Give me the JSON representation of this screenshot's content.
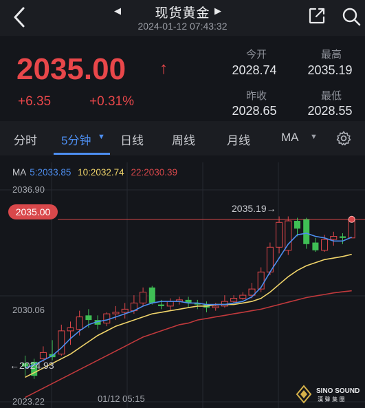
{
  "header": {
    "title": "现货黄金",
    "timestamp": "2024-01-12 07:43:32"
  },
  "quote": {
    "price": "2035.00",
    "change": "+6.35",
    "change_pct": "+0.31%",
    "open_label": "今开",
    "open": "2028.74",
    "high_label": "最高",
    "high": "2035.19",
    "prev_close_label": "昨收",
    "prev_close": "2028.65",
    "low_label": "最低",
    "low": "2028.55"
  },
  "tabs": [
    {
      "label": "分时"
    },
    {
      "label": "5分钟"
    },
    {
      "label": "日线"
    },
    {
      "label": "周线"
    },
    {
      "label": "月线"
    },
    {
      "label": "MA"
    }
  ],
  "indicators": {
    "ma_label": "MA",
    "ma5": "5:2033.85",
    "ma10": "10:2032.74",
    "ma22": "22:2030.39"
  },
  "axis": {
    "top": "2036.90",
    "mid": "2030.06",
    "bottom": "2023.22",
    "time_label": "01/12 05:15"
  },
  "chart": {
    "current_price_badge": "2035.00",
    "high_annotation": "2035.19→",
    "low_annotation": "←2024.93"
  },
  "logo": {
    "line1": "SINO SOUND",
    "line2": "漢 聲 集 團"
  },
  "chart_data": {
    "type": "candlestick",
    "title": "",
    "ylim": [
      2023.22,
      2036.9
    ],
    "current_price": 2035.0,
    "high": 2035.19,
    "low": 2024.93,
    "candles": [
      {
        "o": 2025.7,
        "c": 2025.5,
        "h": 2026.2,
        "l": 2024.9
      },
      {
        "o": 2025.8,
        "c": 2024.9,
        "h": 2026.0,
        "l": 2024.7
      },
      {
        "o": 2026.0,
        "c": 2026.4,
        "h": 2026.8,
        "l": 2025.8
      },
      {
        "o": 2026.3,
        "c": 2026.1,
        "h": 2027.2,
        "l": 2025.9
      },
      {
        "o": 2026.3,
        "c": 2027.8,
        "h": 2028.2,
        "l": 2026.2
      },
      {
        "o": 2027.8,
        "c": 2028.0,
        "h": 2028.4,
        "l": 2026.9
      },
      {
        "o": 2027.9,
        "c": 2028.7,
        "h": 2029.1,
        "l": 2027.5
      },
      {
        "o": 2028.8,
        "c": 2028.5,
        "h": 2029.2,
        "l": 2028.0
      },
      {
        "o": 2028.5,
        "c": 2028.2,
        "h": 2028.8,
        "l": 2027.9
      },
      {
        "o": 2028.3,
        "c": 2028.9,
        "h": 2029.0,
        "l": 2028.1
      },
      {
        "o": 2028.9,
        "c": 2029.0,
        "h": 2029.4,
        "l": 2028.5
      },
      {
        "o": 2029.0,
        "c": 2029.2,
        "h": 2029.6,
        "l": 2028.6
      },
      {
        "o": 2029.1,
        "c": 2029.6,
        "h": 2030.1,
        "l": 2028.9
      },
      {
        "o": 2029.6,
        "c": 2030.3,
        "h": 2030.6,
        "l": 2029.4
      },
      {
        "o": 2030.6,
        "c": 2029.6,
        "h": 2030.7,
        "l": 2029.5
      },
      {
        "o": 2029.5,
        "c": 2029.4,
        "h": 2029.8,
        "l": 2029.2
      },
      {
        "o": 2029.4,
        "c": 2029.7,
        "h": 2029.9,
        "l": 2029.1
      },
      {
        "o": 2029.7,
        "c": 2029.8,
        "h": 2030.0,
        "l": 2029.5
      },
      {
        "o": 2029.8,
        "c": 2029.6,
        "h": 2030.0,
        "l": 2029.3
      },
      {
        "o": 2029.6,
        "c": 2029.5,
        "h": 2029.8,
        "l": 2029.2
      },
      {
        "o": 2029.5,
        "c": 2029.3,
        "h": 2029.7,
        "l": 2029.0
      },
      {
        "o": 2029.3,
        "c": 2029.4,
        "h": 2029.6,
        "l": 2029.1
      },
      {
        "o": 2029.4,
        "c": 2029.7,
        "h": 2030.1,
        "l": 2029.3
      },
      {
        "o": 2029.7,
        "c": 2029.9,
        "h": 2030.1,
        "l": 2029.6
      },
      {
        "o": 2029.9,
        "c": 2030.1,
        "h": 2030.3,
        "l": 2029.8
      },
      {
        "o": 2030.1,
        "c": 2030.5,
        "h": 2030.9,
        "l": 2029.9
      },
      {
        "o": 2030.5,
        "c": 2031.6,
        "h": 2031.9,
        "l": 2030.3
      },
      {
        "o": 2031.6,
        "c": 2033.2,
        "h": 2033.5,
        "l": 2031.4
      },
      {
        "o": 2033.2,
        "c": 2034.8,
        "h": 2035.19,
        "l": 2032.8
      },
      {
        "o": 2033.0,
        "c": 2034.9,
        "h": 2035.19,
        "l": 2032.7
      },
      {
        "o": 2034.9,
        "c": 2034.4,
        "h": 2035.1,
        "l": 2033.9
      },
      {
        "o": 2035.0,
        "c": 2033.4,
        "h": 2035.1,
        "l": 2033.1
      },
      {
        "o": 2033.5,
        "c": 2033.0,
        "h": 2033.8,
        "l": 2032.9
      },
      {
        "o": 2033.0,
        "c": 2033.7,
        "h": 2034.0,
        "l": 2032.9
      },
      {
        "o": 2033.7,
        "c": 2033.9,
        "h": 2034.2,
        "l": 2033.3
      },
      {
        "o": 2033.9,
        "c": 2033.8,
        "h": 2034.1,
        "l": 2033.4
      },
      {
        "o": 2033.8,
        "c": 2035.0,
        "h": 2035.19,
        "l": 2033.8
      }
    ],
    "ma5": [
      2025.4,
      2025.6,
      2025.9,
      2026.2,
      2026.7,
      2027.3,
      2027.8,
      2028.2,
      2028.4,
      2028.5,
      2028.7,
      2028.9,
      2029.1,
      2029.4,
      2029.6,
      2029.7,
      2029.7,
      2029.7,
      2029.6,
      2029.6,
      2029.5,
      2029.5,
      2029.5,
      2029.6,
      2029.7,
      2030.0,
      2030.6,
      2031.6,
      2032.5,
      2033.4,
      2034.0,
      2034.1,
      2033.9,
      2033.8,
      2033.6,
      2033.6,
      2033.85
    ],
    "ma10": [
      2024.8,
      2025.1,
      2025.4,
      2025.7,
      2026.0,
      2026.3,
      2026.7,
      2027.1,
      2027.5,
      2027.8,
      2028.1,
      2028.3,
      2028.5,
      2028.7,
      2028.9,
      2029.0,
      2029.1,
      2029.2,
      2029.3,
      2029.4,
      2029.4,
      2029.5,
      2029.5,
      2029.5,
      2029.6,
      2029.7,
      2029.9,
      2030.3,
      2030.8,
      2031.3,
      2031.7,
      2032.0,
      2032.2,
      2032.4,
      2032.5,
      2032.6,
      2032.74
    ],
    "ma22": [
      2023.5,
      2023.8,
      2024.1,
      2024.4,
      2024.7,
      2025.0,
      2025.3,
      2025.6,
      2025.9,
      2026.2,
      2026.5,
      2026.8,
      2027.1,
      2027.4,
      2027.6,
      2027.8,
      2028.0,
      2028.2,
      2028.3,
      2028.5,
      2028.6,
      2028.7,
      2028.8,
      2028.9,
      2029.0,
      2029.1,
      2029.2,
      2029.35,
      2029.5,
      2029.65,
      2029.8,
      2029.95,
      2030.05,
      2030.15,
      2030.25,
      2030.32,
      2030.39
    ]
  }
}
